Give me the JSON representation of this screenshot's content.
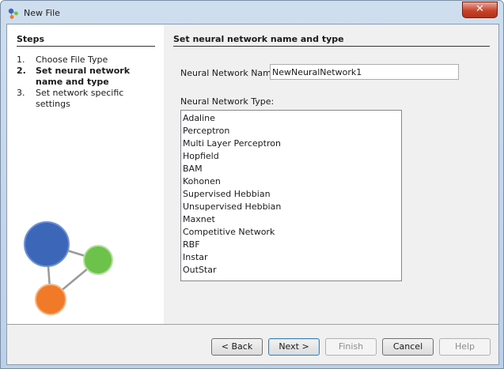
{
  "window": {
    "title": "New File",
    "close_symbol": "✕"
  },
  "steps": {
    "title": "Steps",
    "items": [
      {
        "num": "1.",
        "label": "Choose File Type"
      },
      {
        "num": "2.",
        "label": "Set neural network name and type"
      },
      {
        "num": "3.",
        "label": "Set network specific settings"
      }
    ]
  },
  "panel": {
    "title": "Set neural network name and type",
    "name_label": "Neural Network Name:",
    "name_value": "NewNeuralNetwork1",
    "type_label": "Neural Network Type:",
    "types": [
      "Adaline",
      "Perceptron",
      "Multi Layer Perceptron",
      "Hopfield",
      "BAM",
      "Kohonen",
      "Supervised Hebbian",
      "Unsupervised Hebbian",
      "Maxnet",
      "Competitive Network",
      "RBF",
      "Instar",
      "OutStar"
    ]
  },
  "buttons": {
    "back": "< Back",
    "next": "Next >",
    "finish": "Finish",
    "cancel": "Cancel",
    "help": "Help"
  },
  "icons": {
    "app": "neuroph-network-icon",
    "graphic": "neural-network-graphic"
  },
  "colors": {
    "node_blue": "#3c66b8",
    "node_green": "#6cc24a",
    "node_orange": "#f07a28",
    "default_button_border": "#3c7fb1"
  }
}
